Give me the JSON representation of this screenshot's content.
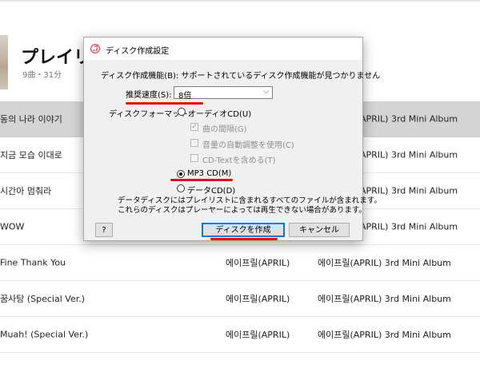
{
  "playlist": {
    "title": "プレイリス",
    "subtitle": "9曲・31分"
  },
  "tracks": [
    {
      "title": "동의 나라 이야기",
      "artist": "",
      "album": "APRIL) 3rd Mini Album"
    },
    {
      "title": "지금 모습 이대로",
      "artist": "",
      "album": "APRIL) 3rd Mini Album"
    },
    {
      "title": "시간아 멈춰라",
      "artist": "",
      "album": "APRIL) 3rd Mini Album"
    },
    {
      "title": "WOW",
      "artist": "",
      "album": "APRIL) 3rd Mini Album"
    },
    {
      "title": "Fine Thank You",
      "artist": "에이프릴(APRIL)",
      "album": "에이프릴(APRIL) 3rd Mini Album"
    },
    {
      "title": "꿈사탕 (Special Ver.)",
      "artist": "에이프릴(APRIL)",
      "album": "에이프릴(APRIL) 3rd Mini Album"
    },
    {
      "title": "Muah! (Special Ver.)",
      "artist": "에이프릴(APRIL)",
      "album": "에이프릴(APRIL) 3rd Mini Album"
    }
  ],
  "dialog": {
    "title": "ディスク作成設定",
    "info": "ディスク作成機能(B): サポートされているディスク作成機能が見つかりません",
    "speed_label": "推奨速度(S):",
    "speed_value": "8倍",
    "format_label": "ディスクフォーマット:",
    "opt_audio": "オーディオCD(U)",
    "opt_gap": "曲の間隔(G)",
    "opt_volume": "音量の自動調整を使用(C)",
    "opt_cdtext": "CD-Textを含める(T)",
    "opt_mp3": "MP3 CD(M)",
    "opt_data": "データCD(D)",
    "note_line1": "データディスクにはプレイリストに含まれるすべてのファイルが含まれます。",
    "note_line2": "これらのディスクはプレーヤーによっては再生できない場合があります。",
    "help_label": "?",
    "create_label": "ディスクを作成",
    "cancel_label": "キャンセル",
    "selected_format": "MP3 CD(M)"
  },
  "colors": {
    "annotation": "#e01010",
    "default_button_border": "#0078d7",
    "selected_row": "#d4d4d4"
  }
}
